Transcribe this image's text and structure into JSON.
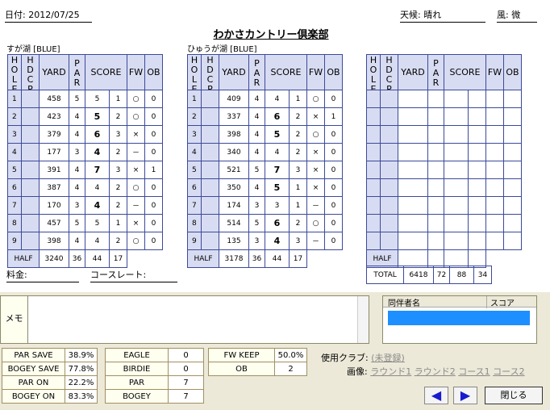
{
  "header": {
    "date": "日付: 2012/07/25",
    "weather": "天候: 晴れ",
    "wind": "風: 微",
    "course_name": "わかさカントリー倶楽部"
  },
  "out_course": "すが湖 [BLUE]",
  "in_course": "ひゅうが湖 [BLUE]",
  "headers": {
    "hole": "HOLE",
    "hdcp": "HDCP",
    "yard": "YARD",
    "par": "PAR",
    "score": "SCORE",
    "fw": "FW",
    "ob": "OB"
  },
  "out": {
    "rows": [
      [
        "1",
        "",
        "458",
        "5",
        "5",
        "1",
        "○",
        "0"
      ],
      [
        "2",
        "",
        "423",
        "4",
        "5",
        "2",
        "○",
        "0"
      ],
      [
        "3",
        "",
        "379",
        "4",
        "6",
        "3",
        "×",
        "0"
      ],
      [
        "4",
        "",
        "177",
        "3",
        "4",
        "2",
        "－",
        "0"
      ],
      [
        "5",
        "",
        "391",
        "4",
        "7",
        "3",
        "×",
        "1"
      ],
      [
        "6",
        "",
        "387",
        "4",
        "4",
        "2",
        "○",
        "0"
      ],
      [
        "7",
        "",
        "170",
        "3",
        "4",
        "2",
        "－",
        "0"
      ],
      [
        "8",
        "",
        "457",
        "5",
        "5",
        "1",
        "×",
        "0"
      ],
      [
        "9",
        "",
        "398",
        "4",
        "4",
        "2",
        "○",
        "0"
      ]
    ],
    "half": {
      "label": "HALF",
      "yard": "3240",
      "par": "36",
      "score": "44",
      "putts": "17"
    }
  },
  "in": {
    "rows": [
      [
        "1",
        "",
        "409",
        "4",
        "4",
        "1",
        "○",
        "0"
      ],
      [
        "2",
        "",
        "337",
        "4",
        "6",
        "2",
        "×",
        "1"
      ],
      [
        "3",
        "",
        "398",
        "4",
        "5",
        "2",
        "○",
        "0"
      ],
      [
        "4",
        "",
        "340",
        "4",
        "4",
        "2",
        "×",
        "0"
      ],
      [
        "5",
        "",
        "521",
        "5",
        "7",
        "3",
        "×",
        "0"
      ],
      [
        "6",
        "",
        "350",
        "4",
        "5",
        "1",
        "×",
        "0"
      ],
      [
        "7",
        "",
        "174",
        "3",
        "3",
        "1",
        "－",
        "0"
      ],
      [
        "8",
        "",
        "514",
        "5",
        "6",
        "2",
        "○",
        "0"
      ],
      [
        "9",
        "",
        "135",
        "3",
        "4",
        "3",
        "－",
        "0"
      ]
    ],
    "half": {
      "label": "HALF",
      "yard": "3178",
      "par": "36",
      "score": "44",
      "putts": "17"
    }
  },
  "total": {
    "half_label": "HALF",
    "label": "TOTAL",
    "yard": "6418",
    "par": "72",
    "score": "88",
    "putts": "34"
  },
  "fee_label": "料金:",
  "rating_label": "コースレート:",
  "memo_label": "メモ",
  "companions": {
    "name_header": "同伴者名",
    "score_header": "スコア"
  },
  "stats1": [
    [
      "PAR SAVE",
      "38.9%"
    ],
    [
      "BOGEY SAVE",
      "77.8%"
    ],
    [
      "PAR ON",
      "22.2%"
    ],
    [
      "BOGEY ON",
      "83.3%"
    ]
  ],
  "stats2": [
    [
      "EAGLE",
      "0"
    ],
    [
      "BIRDIE",
      "0"
    ],
    [
      "PAR",
      "7"
    ],
    [
      "BOGEY",
      "7"
    ]
  ],
  "stats3": [
    [
      "FW KEEP",
      "50.0%"
    ],
    [
      "OB",
      "2"
    ]
  ],
  "clubs": {
    "label": "使用クラブ:",
    "value": "(未登録)"
  },
  "images": {
    "label": "画像:",
    "links": [
      "ラウンド1",
      "ラウンド2",
      "コース1",
      "コース2"
    ]
  },
  "nav": {
    "prev": "◀",
    "next": "▶",
    "close": "閉じる"
  }
}
